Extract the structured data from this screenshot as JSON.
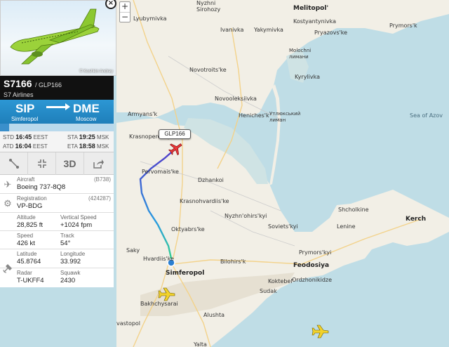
{
  "map": {
    "zoom_in": "+",
    "zoom_out": "−",
    "flight_tag": "GLP166",
    "sea_label": "Sea of Azov",
    "towns": [
      "Nyzhni\nSirohozy",
      "Melitopol'",
      "Lyubymivka",
      "Yakymivka",
      "Kostyantynivka",
      "Ivanivka",
      "Pryazovs'ke",
      "Prymors'k",
      "Molochni\nлимани",
      "Kyrylivka",
      "Novotroits'ke",
      "Novooleksiivka",
      "Heniches'k",
      "Утлюкський\nлиман",
      "Armyans'k",
      "Krasnoperekops'k",
      "Pervomais'ke",
      "Dzhankoi",
      "Krasnohvardiis'ke",
      "Nyzhn'ohirs'kyi",
      "Shcholkine",
      "Kerch",
      "Soviets'kyi",
      "Lenine",
      "Oktyabrs'ke",
      "Saky",
      "Hvardiis'ke",
      "Bilohirs'k",
      "Prymors'kyi",
      "Simferopol",
      "Feodosiya",
      "Bakhchysarai",
      "Koktebel'",
      "Ordzhonikidze",
      "Sudak",
      "Alushta",
      "vastopol",
      "Yalta"
    ]
  },
  "panel": {
    "photo_credit": "© Koshkin Andrey",
    "close_label": "×",
    "flight_number": "S7166",
    "callsign": "/ GLP166",
    "airline": "S7 Airlines",
    "origin_code": "SIP",
    "origin_city": "Simferopol",
    "dest_code": "DME",
    "dest_city": "Moscow",
    "progress": 0.08,
    "std_label": "STD",
    "std_time": "16:45",
    "std_tz": "EEST",
    "atd_label": "ATD",
    "atd_time": "16:04",
    "atd_tz": "EEST",
    "sta_label": "STA",
    "sta_time": "19:25",
    "sta_tz": "MSK",
    "eta_label": "ETA",
    "eta_time": "18:58",
    "eta_tz": "MSK",
    "tools": [
      "route-icon",
      "fullscreen-icon",
      "3D",
      "share-icon"
    ],
    "tool_3d": "3D",
    "aircraft_label": "Aircraft",
    "aircraft_value": "Boeing 737-8Q8",
    "aircraft_code": "(B738)",
    "registration_label": "Registration",
    "registration_value": "VP-BDG",
    "registration_code": "(424287)",
    "altitude_label": "Altitude",
    "altitude_value": "28,825 ft",
    "vspeed_label": "Vertical Speed",
    "vspeed_value": "+1024 fpm",
    "speed_label": "Speed",
    "speed_value": "426 kt",
    "track_label": "Track",
    "track_value": "54°",
    "lat_label": "Latitude",
    "lat_value": "45.8764",
    "lon_label": "Longitude",
    "lon_value": "33.992",
    "radar_label": "Radar",
    "radar_value": "T-UKFF4",
    "squawk_label": "Squawk",
    "squawk_value": "2430"
  },
  "colors": {
    "sea": "#bfdde6",
    "land": "#f2efe6",
    "accent": "#2c97d4",
    "route_start": "#3bb7a0",
    "route_end": "#4a3fcf"
  }
}
